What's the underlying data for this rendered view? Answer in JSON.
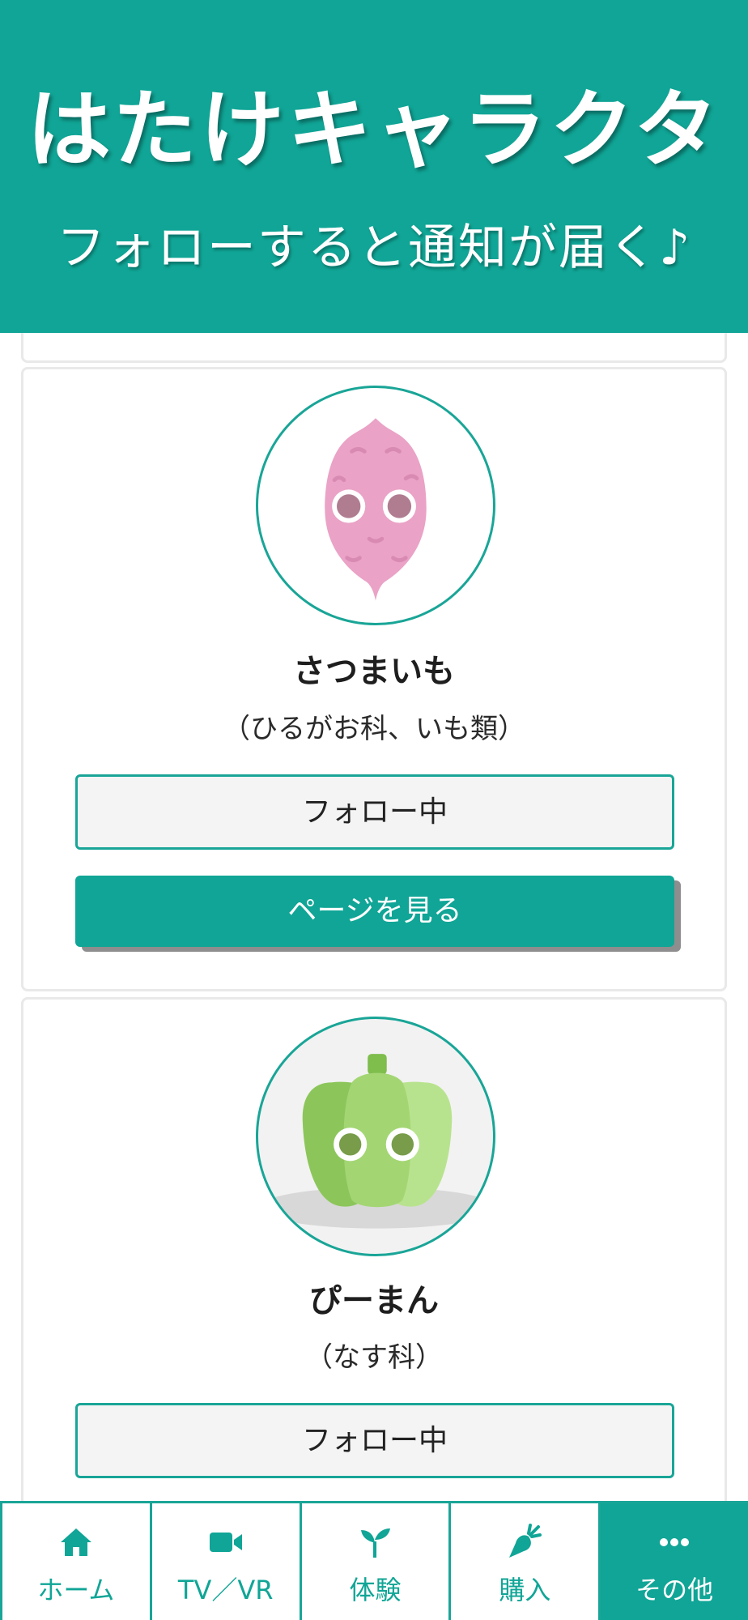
{
  "header": {
    "title": "はたけキャラクタ",
    "subtitle": "フォローすると通知が届く♪"
  },
  "characters": [
    {
      "name": "さつまいも",
      "family": "（ひるがお科、いも類）",
      "follow_label": "フォロー中",
      "page_label": "ページを見る",
      "icon": "sweet-potato-character"
    },
    {
      "name": "ぴーまん",
      "family": "（なす科）",
      "follow_label": "フォロー中",
      "icon": "green-pepper-character"
    }
  ],
  "nav": {
    "items": [
      {
        "label": "ホーム",
        "icon": "home-icon"
      },
      {
        "label": "TV／VR",
        "icon": "video-camera-icon"
      },
      {
        "label": "体験",
        "icon": "sprout-icon"
      },
      {
        "label": "購入",
        "icon": "carrot-icon"
      },
      {
        "label": "その他",
        "icon": "more-dots-icon",
        "active": true
      }
    ]
  },
  "colors": {
    "accent": "#10a596",
    "border": "#19a597",
    "follow_bg": "#f4f4f4",
    "sweet_potato": "#eaa2c6",
    "pepper": "#a3d673"
  }
}
